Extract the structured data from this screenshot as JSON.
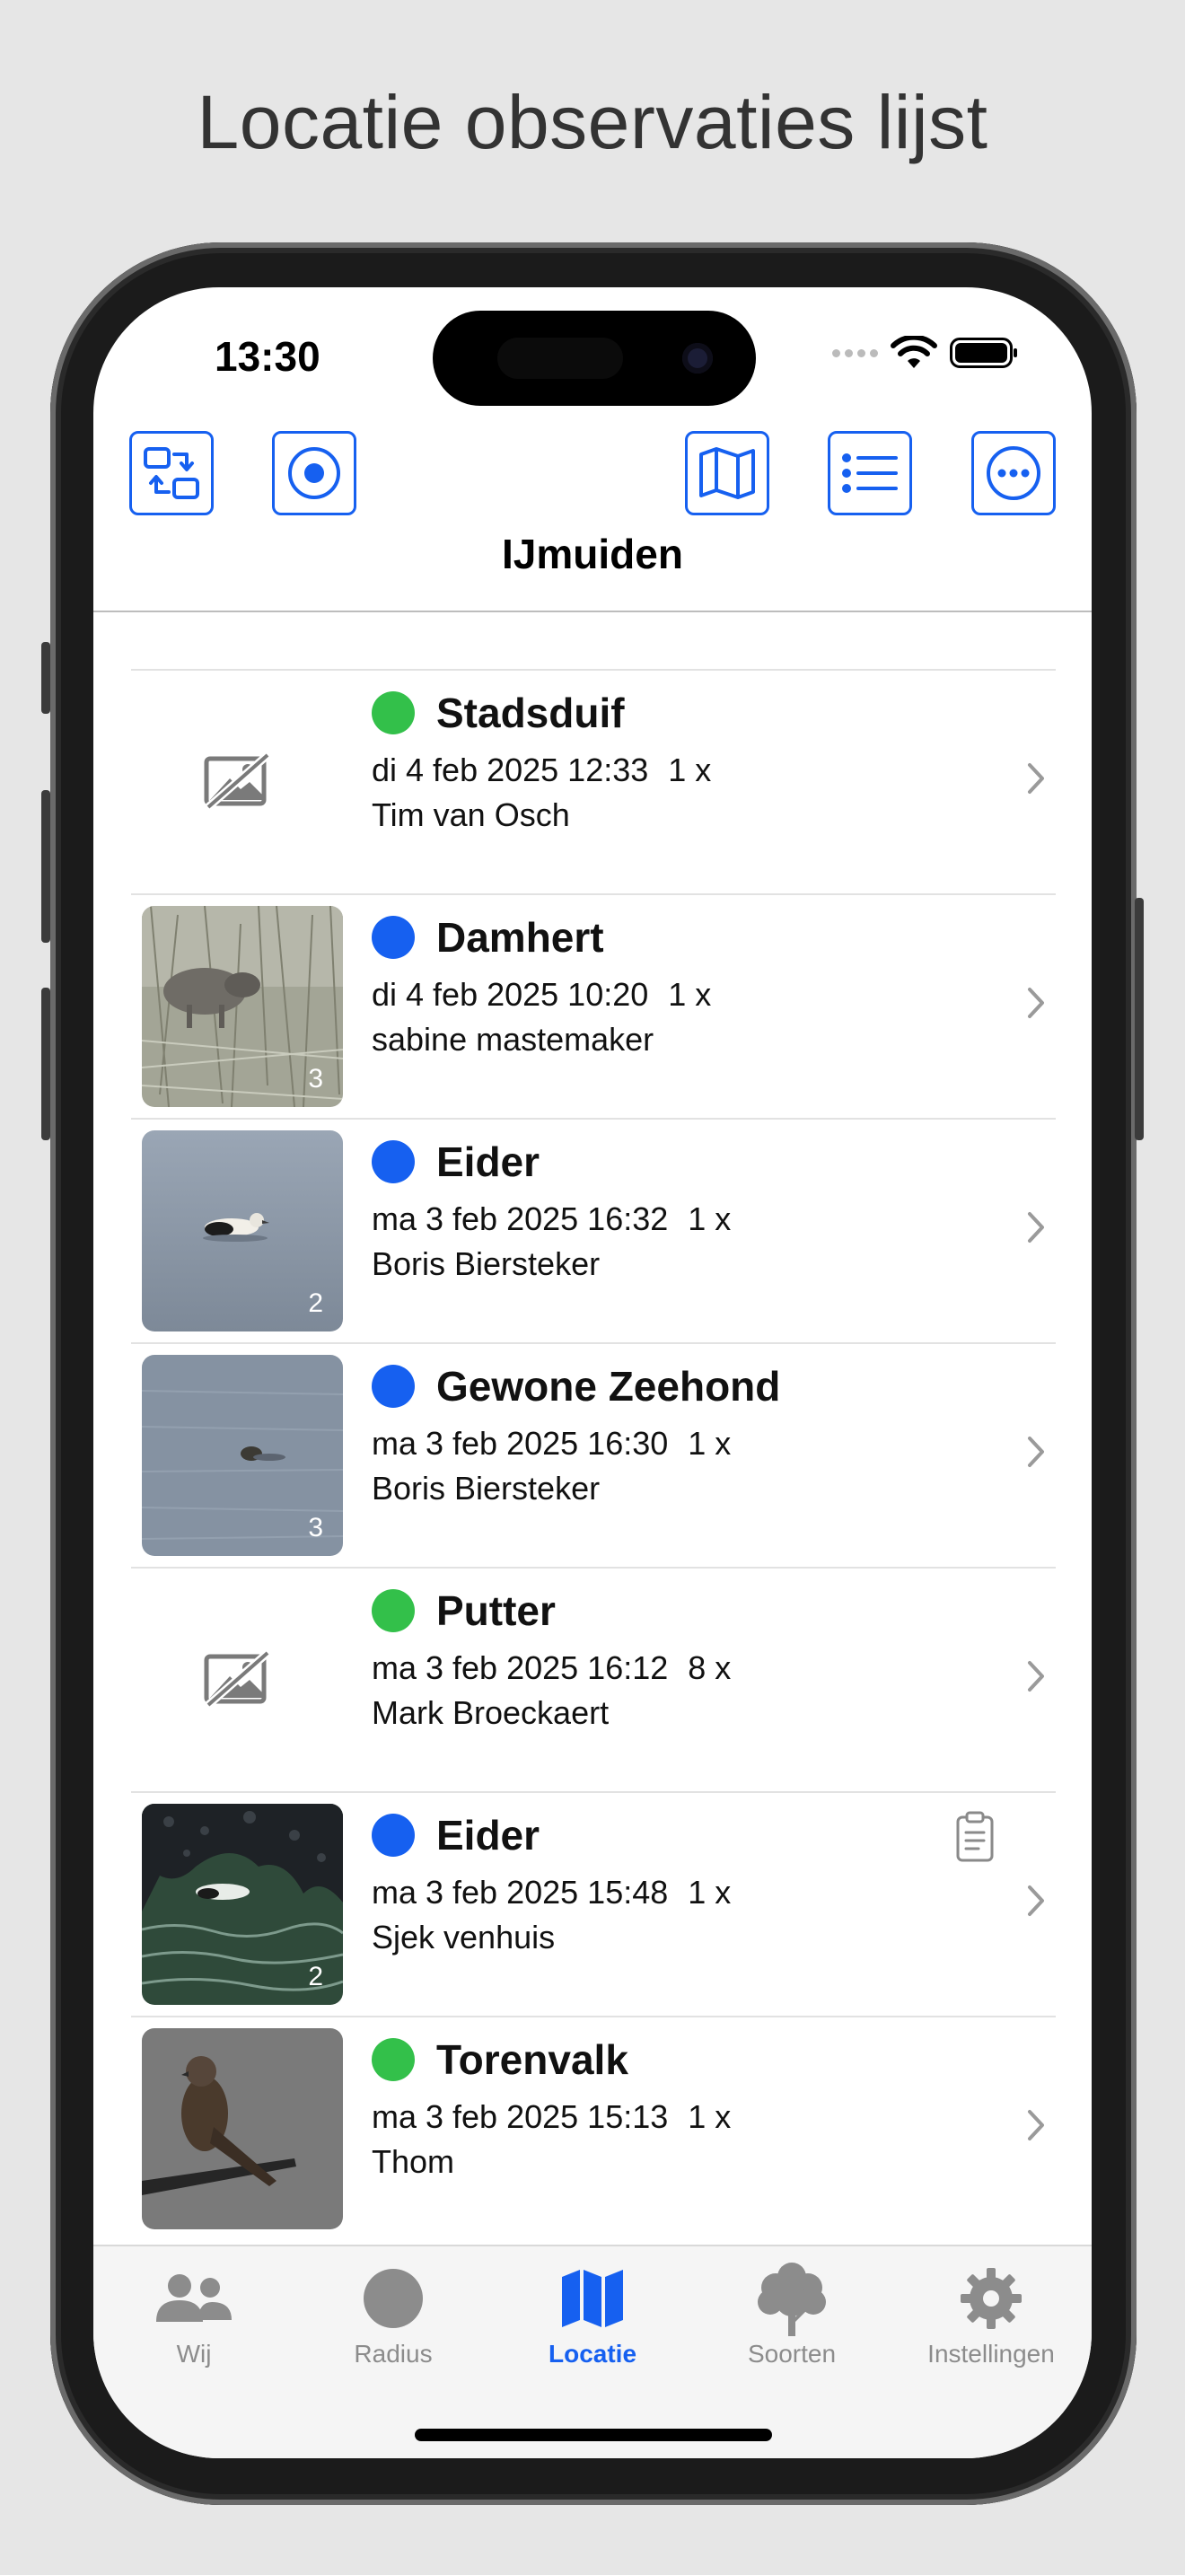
{
  "headline": "Locatie observaties lijst",
  "status": {
    "time": "13:30"
  },
  "location_title": "IJmuiden",
  "toolbar": {
    "buttons": [
      {
        "icon": "switch-icon"
      },
      {
        "icon": "target-icon"
      },
      {
        "icon": "map-icon"
      },
      {
        "icon": "list-icon"
      },
      {
        "icon": "more-icon"
      }
    ]
  },
  "observations": [
    {
      "species": "Stadsduif",
      "status_color": "#33c04a",
      "date": "di 4 feb 2025 12:33",
      "count": "1 x",
      "observer": "Tim van Osch",
      "photos": "",
      "has_photo": false,
      "has_note": false
    },
    {
      "species": "Damhert",
      "status_color": "#1660f0",
      "date": "di 4 feb 2025 10:20",
      "count": "1 x",
      "observer": "sabine mastemaker",
      "photos": "3",
      "has_photo": true,
      "has_note": false
    },
    {
      "species": "Eider",
      "status_color": "#1660f0",
      "date": "ma 3 feb 2025 16:32",
      "count": "1 x",
      "observer": "Boris Biersteker",
      "photos": "2",
      "has_photo": true,
      "has_note": false
    },
    {
      "species": "Gewone Zeehond",
      "status_color": "#1660f0",
      "date": "ma 3 feb 2025 16:30",
      "count": "1 x",
      "observer": "Boris Biersteker",
      "photos": "3",
      "has_photo": true,
      "has_note": false
    },
    {
      "species": "Putter",
      "status_color": "#33c04a",
      "date": "ma 3 feb 2025 16:12",
      "count": "8 x",
      "observer": "Mark Broeckaert",
      "photos": "",
      "has_photo": false,
      "has_note": false
    },
    {
      "species": "Eider",
      "status_color": "#1660f0",
      "date": "ma 3 feb 2025 15:48",
      "count": "1 x",
      "observer": "Sjek venhuis",
      "photos": "2",
      "has_photo": true,
      "has_note": true
    },
    {
      "species": "Torenvalk",
      "status_color": "#33c04a",
      "date": "ma 3 feb 2025 15:13",
      "count": "1 x",
      "observer": "Thom",
      "photos": "",
      "has_photo": true,
      "has_note": false
    }
  ],
  "tabs": [
    {
      "label": "Wij",
      "icon": "people-icon",
      "active": false
    },
    {
      "label": "Radius",
      "icon": "circle-icon",
      "active": false
    },
    {
      "label": "Locatie",
      "icon": "map-icon",
      "active": true
    },
    {
      "label": "Soorten",
      "icon": "tree-icon",
      "active": false
    },
    {
      "label": "Instellingen",
      "icon": "gear-icon",
      "active": false
    }
  ],
  "colors": {
    "accent": "#1660f0",
    "green": "#33c04a",
    "inactive": "#8c8c8c"
  }
}
